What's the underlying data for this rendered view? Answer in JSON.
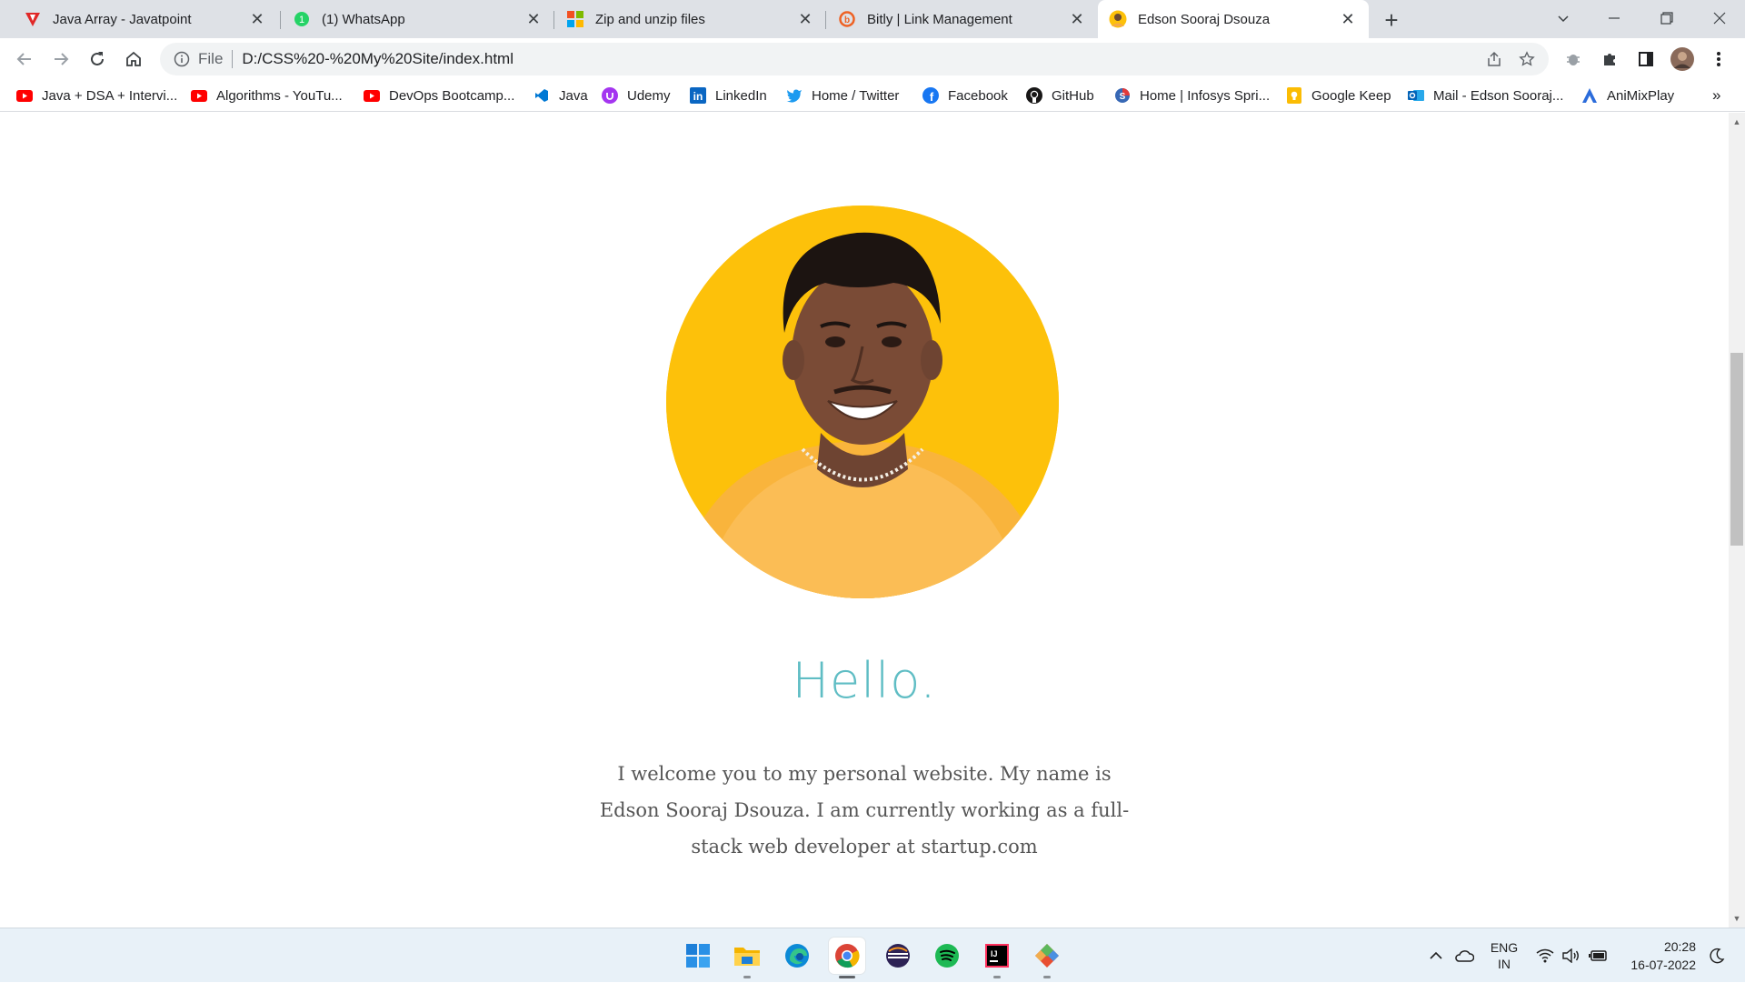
{
  "browser": {
    "tabs": [
      {
        "title": "Java Array - Javatpoint",
        "icon": "javatpoint-icon"
      },
      {
        "title": "(1) WhatsApp",
        "icon": "whatsapp-icon"
      },
      {
        "title": "Zip and unzip files",
        "icon": "microsoft-icon"
      },
      {
        "title": "Bitly | Link Management",
        "icon": "bitly-icon"
      },
      {
        "title": "Edson Sooraj Dsouza",
        "icon": "profile-favicon"
      }
    ],
    "address": {
      "scheme": "File",
      "url": "D:/CSS%20-%20My%20Site/index.html"
    },
    "bookmarks": [
      {
        "label": "Java + DSA + Intervi...",
        "icon": "youtube-icon"
      },
      {
        "label": "Algorithms - YouTu...",
        "icon": "youtube-icon"
      },
      {
        "label": "DevOps Bootcamp...",
        "icon": "youtube-icon"
      },
      {
        "label": "Java",
        "icon": "vscode-icon"
      },
      {
        "label": "Udemy",
        "icon": "udemy-icon"
      },
      {
        "label": "LinkedIn",
        "icon": "linkedin-icon"
      },
      {
        "label": "Home / Twitter",
        "icon": "twitter-icon"
      },
      {
        "label": "Facebook",
        "icon": "facebook-icon"
      },
      {
        "label": "GitHub",
        "icon": "github-icon"
      },
      {
        "label": "Home | Infosys Spri...",
        "icon": "infosys-icon"
      },
      {
        "label": "Google Keep",
        "icon": "keep-icon"
      },
      {
        "label": "Mail - Edson Sooraj...",
        "icon": "outlook-icon"
      },
      {
        "label": "AniMixPlay",
        "icon": "animixplay-icon"
      }
    ],
    "overflow_label": "»"
  },
  "page": {
    "heading": "Hello.",
    "intro": "I welcome you to my personal website. My name is Edson Sooraj Dsouza. I am currently working as a full-stack web developer at startup.com"
  },
  "taskbar": {
    "language_line1": "ENG",
    "language_line2": "IN",
    "time": "20:28",
    "date": "16-07-2022"
  },
  "colors": {
    "accent": "#5fbdc4",
    "portrait_bg": "#fdc10a"
  }
}
